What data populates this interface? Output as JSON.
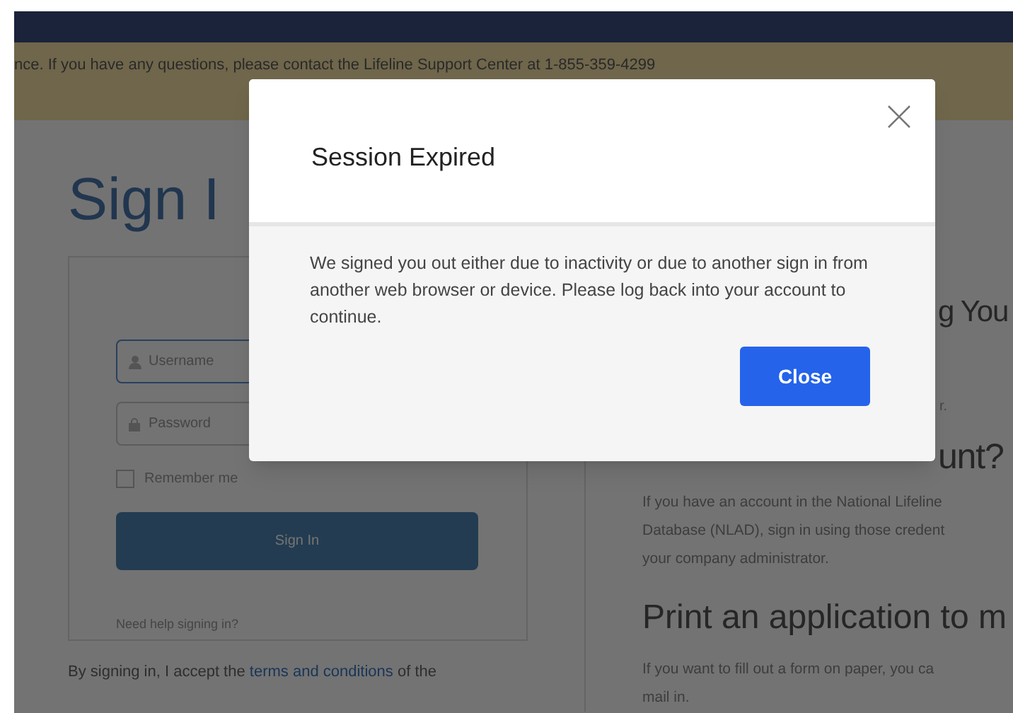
{
  "banner": {
    "text": "nce. If you have any questions, please contact the Lifeline Support Center at 1-855-359-4299"
  },
  "sign_in": {
    "heading": "Sign I",
    "username": {
      "placeholder": "Username"
    },
    "password": {
      "placeholder": "Password"
    },
    "remember_me": {
      "label": "Remember me",
      "checked": false
    },
    "button": "Sign In",
    "help_link": "Need help signing in?",
    "terms": {
      "before": "By signing in, I accept the ",
      "link": "terms and conditions",
      "after": " of the"
    }
  },
  "info": {
    "heading_1": "g You",
    "fragment": "r.",
    "heading_2": "unt?",
    "paragraph_1": [
      "If you have an account in the National Lifeline",
      "Database (NLAD), sign in using those credent",
      "your company administrator."
    ],
    "heading_3": "Print an application to m",
    "paragraph_2": [
      "If you want to fill out a form on paper, you ca",
      "mail in."
    ]
  },
  "dialog": {
    "title": "Session Expired",
    "message": "We signed you out either due to inactivity or due to another sign in from another web browser or device. Please log back into your account to continue.",
    "button": "Close"
  }
}
